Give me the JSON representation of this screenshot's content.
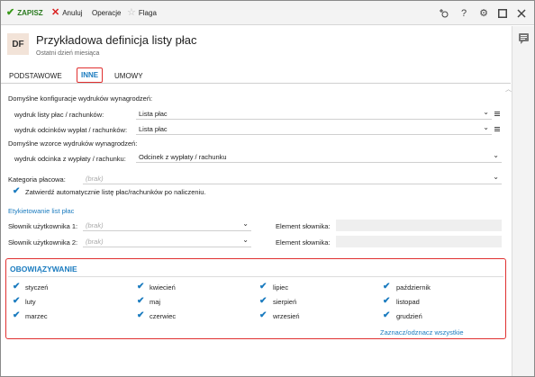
{
  "toolbar": {
    "save_label": "ZAPISZ",
    "cancel_label": "Anuluj",
    "operations_label": "Operacje",
    "flag_label": "Flaga",
    "help_label": "?"
  },
  "header": {
    "badge": "DF",
    "title": "Przykładowa definicja listy płac",
    "subtitle": "Ostatni dzień miesiąca"
  },
  "tabs": [
    {
      "label": "PODSTAWOWE",
      "active": false
    },
    {
      "label": "INNE",
      "active": true
    },
    {
      "label": "UMOWY",
      "active": false
    }
  ],
  "form": {
    "print_config_heading": "Domyślne konfiguracje wydruków wynagrodzeń:",
    "payroll_print_label": "wydruk listy płac / rachunków:",
    "payroll_print_value": "Lista płac",
    "payslip_print_label": "wydruk odcinków wypłat / rachunków:",
    "payslip_print_value": "Lista płac",
    "templates_heading": "Domyślne wzorce wydruków wynagrodzeń:",
    "slip_template_label": "wydruk odcinka z wypłaty / rachunku:",
    "slip_template_value": "Odcinek z wypłaty / rachunku",
    "category_label": "Kategoria płacowa:",
    "category_placeholder": "(brak)",
    "auto_approve_label": "Zatwierdź automatycznie listę płac/rachunków po naliczeniu.",
    "auto_approve_checked": true,
    "tagging_link": "Etykietowanie list płac",
    "dict1_label": "Słownik użytkownika 1:",
    "dict1_placeholder": "(brak)",
    "dict2_label": "Słownik użytkownika 2:",
    "dict2_placeholder": "(brak)",
    "dict_element1_label": "Element słownika:",
    "dict_element2_label": "Element słownika:"
  },
  "validity": {
    "title": "OBOWIĄZYWANIE",
    "months": [
      {
        "label": "styczeń",
        "checked": true
      },
      {
        "label": "luty",
        "checked": true
      },
      {
        "label": "marzec",
        "checked": true
      },
      {
        "label": "kwiecień",
        "checked": true
      },
      {
        "label": "maj",
        "checked": true
      },
      {
        "label": "czerwiec",
        "checked": true
      },
      {
        "label": "lipiec",
        "checked": true
      },
      {
        "label": "sierpień",
        "checked": true
      },
      {
        "label": "wrzesień",
        "checked": true
      },
      {
        "label": "październik",
        "checked": true
      },
      {
        "label": "listopad",
        "checked": true
      },
      {
        "label": "grudzień",
        "checked": true
      }
    ],
    "toggle_all_link": "Zaznacz/odznacz wszystkie"
  },
  "colors": {
    "accent": "#1a7bbf",
    "highlight_border": "#e03030",
    "save_green": "#2a7a1f",
    "badge_bg": "#f2e3d8"
  },
  "icons": {
    "save": "check-icon",
    "cancel": "x-icon",
    "flag": "star-icon",
    "add_toolbar": "add-toolbar-icon",
    "help": "help-icon",
    "settings": "gear-icon",
    "maximize": "maximize-icon",
    "close": "close-icon",
    "comments": "comment-icon"
  }
}
